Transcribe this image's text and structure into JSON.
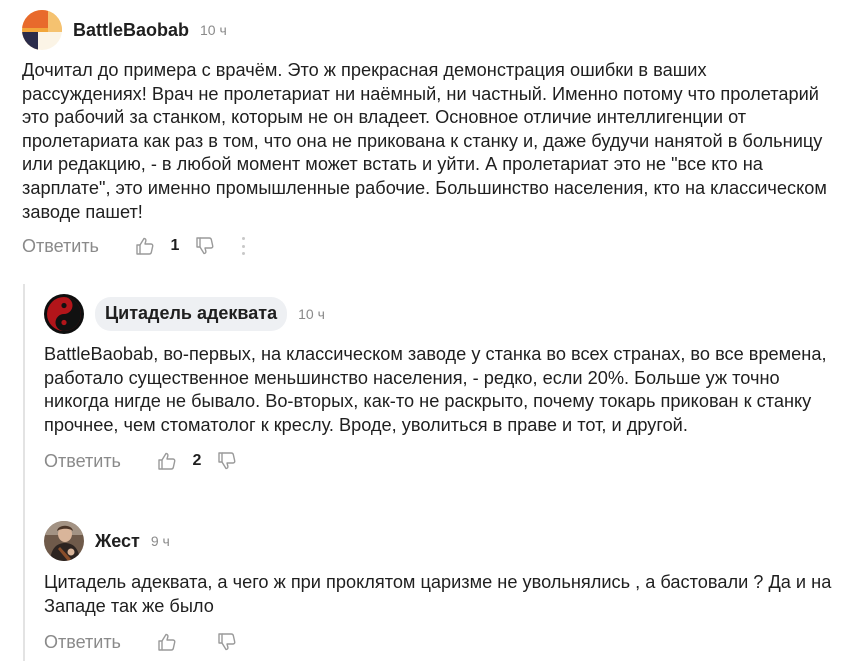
{
  "comments": [
    {
      "author": "BattleBaobab",
      "time": "10 ч",
      "avatar": "battlebaobab-avatar",
      "text": "Дочитал до примера с врачём. Это ж прекрасная демонстрация ошибки в ваших рассуждениях! Врач не пролетариат ни наёмный, ни частный. Именно потому что пролетарий это рабочий за станком, которым не он владеет. Основное отличие интеллигенции от пролетариата как раз в том, что она не прикована к станку и, даже будучи нанятой в больницу или редакцию, - в любой момент может встать и уйти. А пролетариат это не \"все кто на зарплате\", это именно промышленные рабочие. Большинство населения, кто на классическом заводе пашет!",
      "reply_label": "Ответить",
      "likes": "1",
      "icons": {
        "like": "thumb-up-icon",
        "dislike": "thumb-down-icon",
        "more": "more-dots-icon"
      }
    },
    {
      "author": "Цитадель адеквата",
      "time": "10 ч",
      "avatar": "yin-yang-avatar",
      "text": "BattleBaobab, во-первых, на классическом заводе у станка во всех странах, во все времена, работало существенное меньшинство населения, - редко, если 20%. Больше уж точно никогда нигде не бывало. Во-вторых, как-то не раскрыто, почему токарь прикован к станку прочнее, чем стоматолог к креслу. Вроде, уволиться в праве и тот, и другой.",
      "reply_label": "Ответить",
      "likes": "2",
      "icons": {
        "like": "thumb-up-icon",
        "dislike": "thumb-down-icon"
      }
    },
    {
      "author": "Жест",
      "time": "9 ч",
      "avatar": "photo-avatar",
      "text": "Цитадель адеквата, а чего ж при проклятом царизме не увольнялись , а бастовали ? Да и на Западе так же было",
      "reply_label": "Ответить",
      "likes": "",
      "icons": {
        "like": "thumb-up-icon",
        "dislike": "thumb-down-icon"
      }
    }
  ],
  "colors": {
    "text": "#1f1f1f",
    "muted": "#8a8a8a",
    "pill": "#eef0f3",
    "thread_line": "#e3e3e3"
  }
}
